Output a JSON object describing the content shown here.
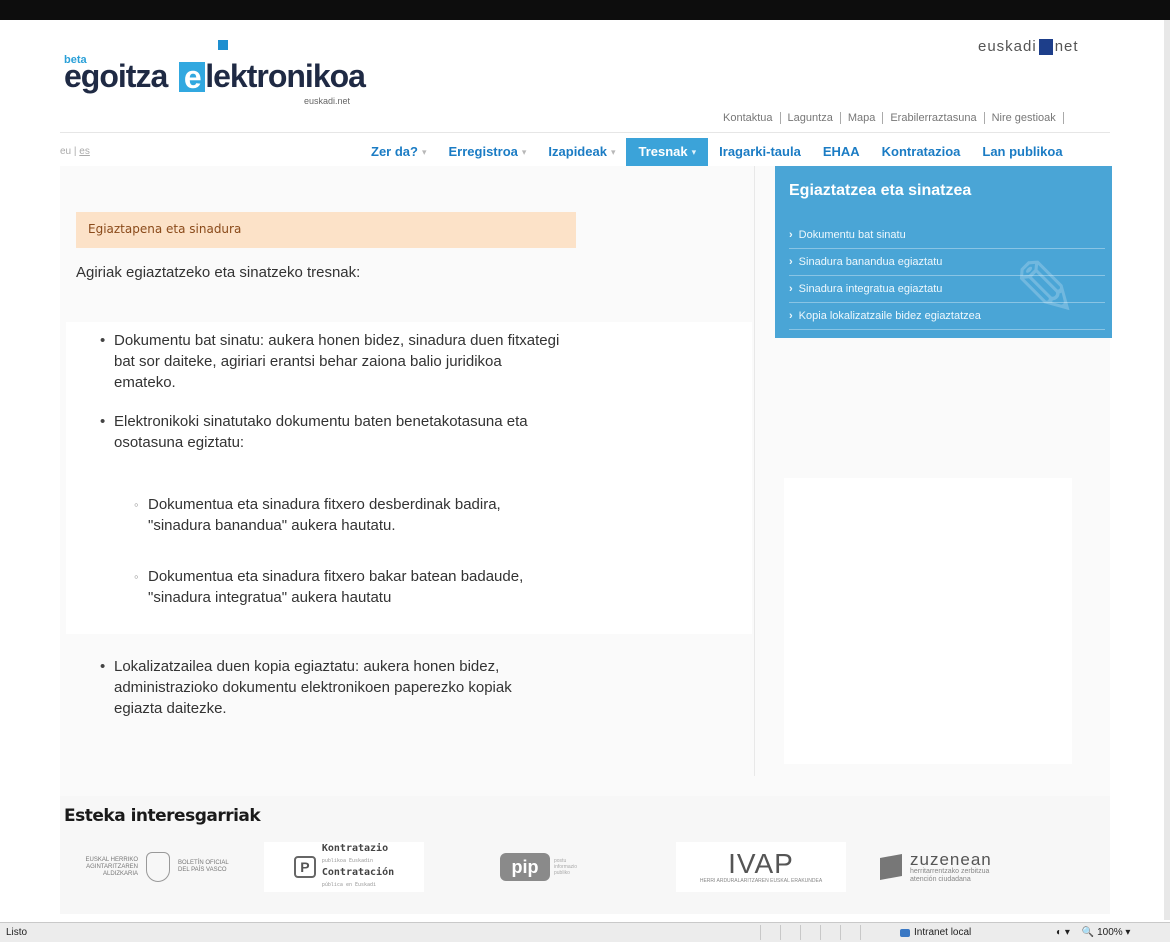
{
  "header": {
    "logo_beta": "beta",
    "logo_part1": "egoitza",
    "logo_e": "e",
    "logo_part2": "lektronikoa",
    "logo_sub": "euskadi.net",
    "euskadi_left": "euskadi",
    "euskadi_right": "net",
    "top_links": [
      "Kontaktua",
      "Laguntza",
      "Mapa",
      "Erabilerraztasuna",
      "Nire gestioak"
    ]
  },
  "lang": {
    "eu": "eu",
    "sep": "|",
    "es": "es"
  },
  "nav": [
    {
      "label": "Zer da?",
      "chev": true,
      "active": false
    },
    {
      "label": "Erregistroa",
      "chev": true,
      "active": false
    },
    {
      "label": "Izapideak",
      "chev": true,
      "active": false
    },
    {
      "label": "Tresnak",
      "chev": true,
      "active": true
    },
    {
      "label": "Iragarki-taula",
      "chev": false,
      "active": false
    },
    {
      "label": "EHAA",
      "chev": false,
      "active": false
    },
    {
      "label": "Kontratazioa",
      "chev": false,
      "active": false
    },
    {
      "label": "Lan publikoa",
      "chev": false,
      "active": false
    }
  ],
  "nav_chev": "▾",
  "main": {
    "crumb": "Egiaztapena eta sinadura",
    "intro": "Agiriak egiaztatzeko eta sinatzeko tresnak:",
    "b1": "Dokumentu bat sinatu: aukera honen bidez, sinadura duen fitxategi bat sor daiteke, agiriari erantsi behar zaiona balio juridikoa emateko.",
    "b2": "Elektronikoki sinatutako dokumentu baten benetakotasuna eta osotasuna egiztatu:",
    "s1": "Dokumentua eta sinadura fitxero desberdinak badira, \"sinadura banandua\" aukera hautatu.",
    "s2": "Dokumentua eta sinadura fitxero bakar batean badaude, \"sinadura integratua\" aukera hautatu",
    "b3": "Lokalizatzailea duen kopia egiaztatu: aukera honen bidez, administrazioko dokumentu elektronikoen paperezko kopiak egiazta daitezke."
  },
  "tools": {
    "title": "Egiaztatzea eta sinatzea",
    "arrow": "›",
    "items": [
      "Dokumentu bat sinatu",
      "Sinadura banandua egiaztatu",
      "Sinadura integratua egiaztatu",
      "Kopia lokalizatzaile bidez egiaztatzea"
    ]
  },
  "footer": {
    "title": "Esteka interesgarriak",
    "bop_left": "EUSKAL HERRIKO AGINTARITZAREN ALDIZKARIA",
    "bop_right": "BOLETÍN OFICIAL DEL PAÍS VASCO",
    "kontr_icon": "P",
    "kontr_1": "Kontratazio",
    "kontr_1s": "publikoa Euskadin",
    "kontr_2": "Contratación",
    "kontr_2s": "pública en Euskadi",
    "pip": "pip",
    "pip_small": "postu informazio publiko",
    "ivap": "IVAP",
    "ivap_small": "HERRI ARDURALARITZAREN EUSKAL ERAKUNDEA",
    "zuz": "zuzenean",
    "zuz_1": "herritarrentzako zerbitzua",
    "zuz_2": "atención ciudadana"
  },
  "status": {
    "left": "Listo",
    "zone": "Intranet local",
    "zoom": "100%"
  }
}
